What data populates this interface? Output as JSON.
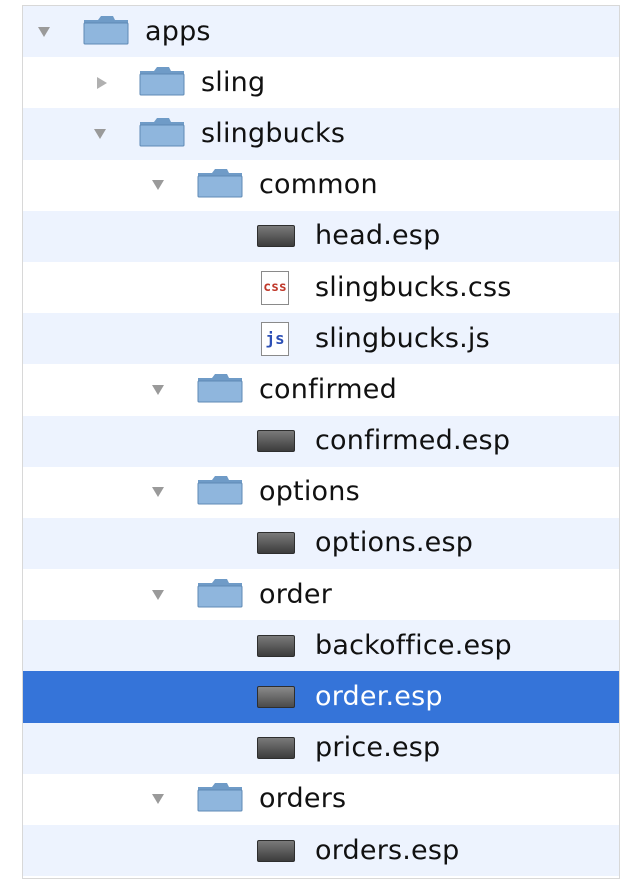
{
  "tree": {
    "rows": [
      {
        "label": "apps",
        "type": "folder",
        "state": "expanded"
      },
      {
        "label": "sling",
        "type": "folder",
        "state": "collapsed"
      },
      {
        "label": "slingbucks",
        "type": "folder",
        "state": "expanded"
      },
      {
        "label": "common",
        "type": "folder",
        "state": "expanded"
      },
      {
        "label": "head.esp",
        "type": "file-esp"
      },
      {
        "label": "slingbucks.css",
        "type": "file-css",
        "icon_text": "css"
      },
      {
        "label": "slingbucks.js",
        "type": "file-js",
        "icon_text": "js"
      },
      {
        "label": "confirmed",
        "type": "folder",
        "state": "expanded"
      },
      {
        "label": "confirmed.esp",
        "type": "file-esp"
      },
      {
        "label": "options",
        "type": "folder",
        "state": "expanded"
      },
      {
        "label": "options.esp",
        "type": "file-esp"
      },
      {
        "label": "order",
        "type": "folder",
        "state": "expanded"
      },
      {
        "label": "backoffice.esp",
        "type": "file-esp"
      },
      {
        "label": "order.esp",
        "type": "file-esp",
        "selected": true
      },
      {
        "label": "price.esp",
        "type": "file-esp"
      },
      {
        "label": "orders",
        "type": "folder",
        "state": "expanded"
      },
      {
        "label": "orders.esp",
        "type": "file-esp"
      }
    ]
  },
  "colors": {
    "selection": "#3574d9",
    "alternate_row": "#edf3fe",
    "folder_fill": "#8fb6dd"
  }
}
